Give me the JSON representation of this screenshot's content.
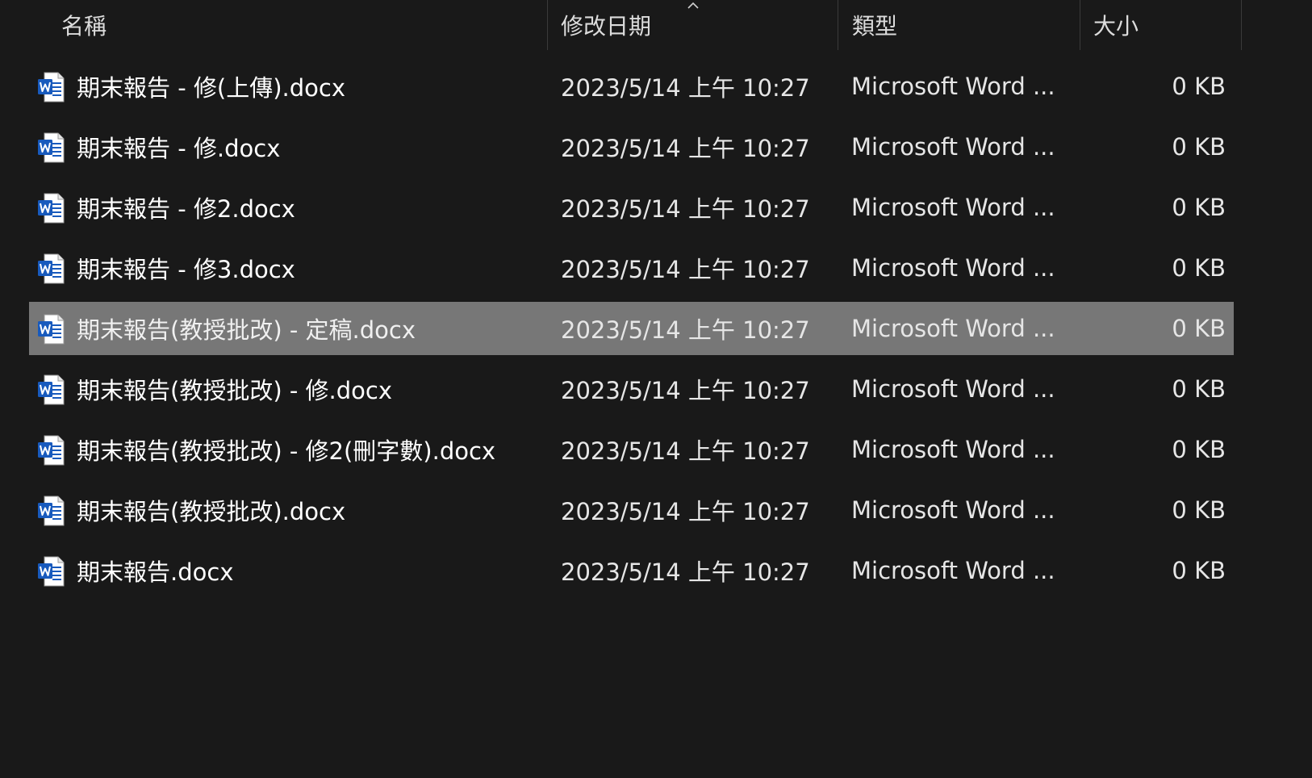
{
  "header": {
    "name_label": "名稱",
    "date_label": "修改日期",
    "type_label": "類型",
    "size_label": "大小",
    "sort_icon": "chevron-up-icon"
  },
  "files": [
    {
      "name": "期末報告 - 修(上傳).docx",
      "date": "2023/5/14 上午 10:27",
      "type": "Microsoft Word ...",
      "size": "0 KB",
      "icon": "word-doc-icon",
      "selected": false
    },
    {
      "name": "期末報告 - 修.docx",
      "date": "2023/5/14 上午 10:27",
      "type": "Microsoft Word ...",
      "size": "0 KB",
      "icon": "word-doc-icon",
      "selected": false
    },
    {
      "name": "期末報告 - 修2.docx",
      "date": "2023/5/14 上午 10:27",
      "type": "Microsoft Word ...",
      "size": "0 KB",
      "icon": "word-doc-icon",
      "selected": false
    },
    {
      "name": "期末報告 - 修3.docx",
      "date": "2023/5/14 上午 10:27",
      "type": "Microsoft Word ...",
      "size": "0 KB",
      "icon": "word-doc-icon",
      "selected": false
    },
    {
      "name": "期末報告(教授批改) - 定稿.docx",
      "date": "2023/5/14 上午 10:27",
      "type": "Microsoft Word ...",
      "size": "0 KB",
      "icon": "word-doc-icon",
      "selected": true
    },
    {
      "name": "期末報告(教授批改) - 修.docx",
      "date": "2023/5/14 上午 10:27",
      "type": "Microsoft Word ...",
      "size": "0 KB",
      "icon": "word-doc-icon",
      "selected": false
    },
    {
      "name": "期末報告(教授批改) - 修2(刪字數).docx",
      "date": "2023/5/14 上午 10:27",
      "type": "Microsoft Word ...",
      "size": "0 KB",
      "icon": "word-doc-icon",
      "selected": false
    },
    {
      "name": "期末報告(教授批改).docx",
      "date": "2023/5/14 上午 10:27",
      "type": "Microsoft Word ...",
      "size": "0 KB",
      "icon": "word-doc-icon",
      "selected": false
    },
    {
      "name": "期末報告.docx",
      "date": "2023/5/14 上午 10:27",
      "type": "Microsoft Word ...",
      "size": "0 KB",
      "icon": "word-doc-icon",
      "selected": false
    }
  ],
  "colors": {
    "background": "#191919",
    "selected_row": "#777777",
    "word_blue": "#185abd",
    "divider": "#3a3a3a"
  }
}
